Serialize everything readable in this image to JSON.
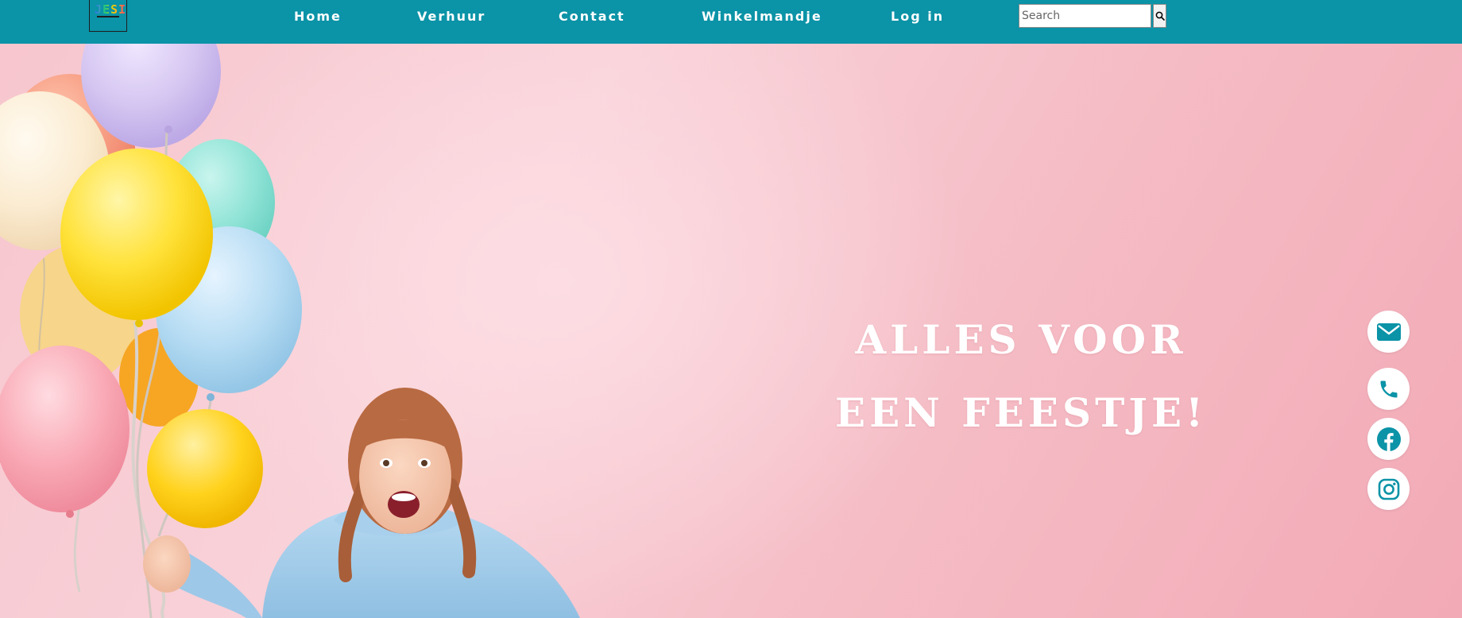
{
  "brand": {
    "logo_text": "JESI"
  },
  "nav": {
    "items": [
      {
        "label": "Home"
      },
      {
        "label": "Verhuur"
      },
      {
        "label": "Contact"
      },
      {
        "label": "Winkelmandje"
      },
      {
        "label": "Log in"
      }
    ]
  },
  "search": {
    "placeholder": "Search",
    "value": ""
  },
  "hero": {
    "title_line1": "ALLES VOOR",
    "title_line2": "EEN FEESTJE!"
  },
  "social": [
    {
      "icon": "envelope-icon"
    },
    {
      "icon": "phone-icon"
    },
    {
      "icon": "facebook-icon"
    },
    {
      "icon": "instagram-icon"
    }
  ],
  "colors": {
    "header": "#0b93a7",
    "accent_icon": "#0b93a7",
    "hero_background": "#f7c6ce",
    "hero_text": "#ffffff"
  }
}
